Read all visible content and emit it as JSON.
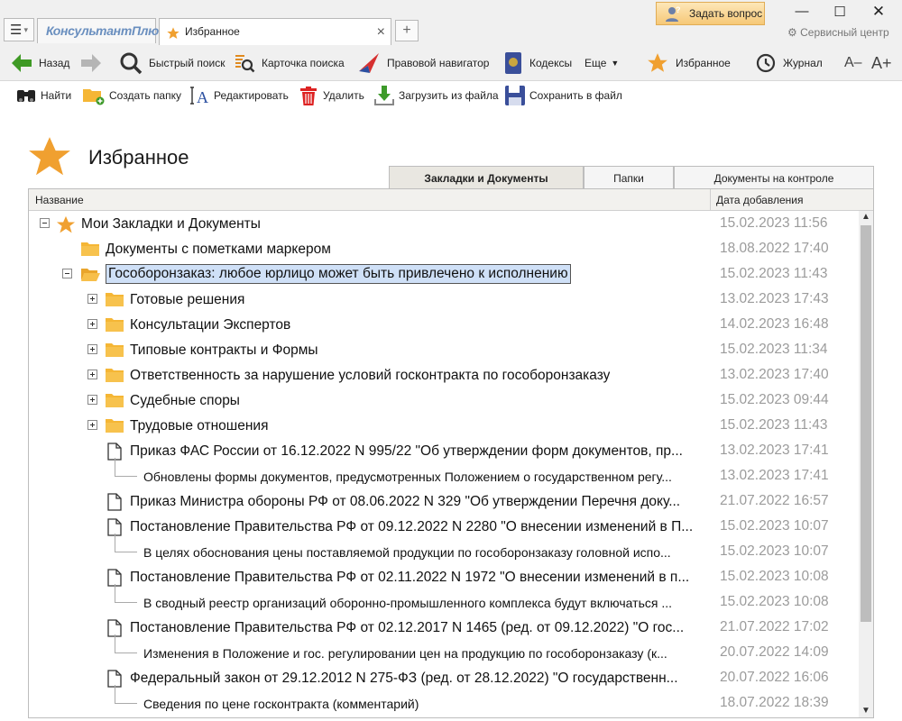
{
  "window": {
    "menu_icon": "hamburger-icon",
    "logo": "КонсультантПлюс",
    "active_tab": "Избранное",
    "ask_question": "Задать вопрос",
    "service_center": "Сервисный центр"
  },
  "toolbar": {
    "back": "Назад",
    "quick_search": "Быстрый поиск",
    "search_card": "Карточка поиска",
    "legal_navigator": "Правовой навигатор",
    "codes": "Кодексы",
    "more": "Еще",
    "favorites": "Избранное",
    "journal": "Журнал",
    "font_smaller": "A–",
    "font_larger": "A+"
  },
  "actions": {
    "find": "Найти",
    "create_folder": "Создать папку",
    "edit": "Редактировать",
    "delete": "Удалить",
    "load_from_file": "Загрузить из файла",
    "save_to_file": "Сохранить в файл"
  },
  "page": {
    "title": "Избранное",
    "tabs": [
      "Закладки и Документы",
      "Папки",
      "Документы на контроле"
    ],
    "active_tab_index": 0
  },
  "table": {
    "col_name": "Название",
    "col_date": "Дата добавления",
    "rows": [
      {
        "type": "root",
        "label": "Мои Закладки и Документы",
        "date": "15.02.2023 11:56"
      },
      {
        "type": "folder",
        "label": "Документы с пометками маркером",
        "date": "18.08.2022 17:40"
      },
      {
        "type": "folder-open",
        "label": "Гособоронзаказ: любое юрлицо может быть привлечено к исполнению",
        "date": "15.02.2023 11:43",
        "selected": true
      },
      {
        "type": "subfolder",
        "label": "Готовые решения",
        "date": "13.02.2023 17:43"
      },
      {
        "type": "subfolder",
        "label": "Консультации Экспертов",
        "date": "14.02.2023 16:48"
      },
      {
        "type": "subfolder",
        "label": "Типовые контракты и Формы",
        "date": "15.02.2023 11:34"
      },
      {
        "type": "subfolder",
        "label": "Ответственность за нарушение условий госконтракта по гособоронзаказу",
        "date": "13.02.2023 17:40"
      },
      {
        "type": "subfolder",
        "label": "Судебные споры",
        "date": "15.02.2023 09:44"
      },
      {
        "type": "subfolder",
        "label": "Трудовые отношения",
        "date": "15.02.2023 11:43"
      },
      {
        "type": "doc",
        "label": "Приказ ФАС России от 16.12.2022 N 995/22 \"Об утверждении форм документов, пр...",
        "date": "13.02.2023 17:41"
      },
      {
        "type": "bookmark",
        "label": "Обновлены формы документов, предусмотренных Положением о государственном регу...",
        "date": "13.02.2023 17:41"
      },
      {
        "type": "doc",
        "label": "Приказ Министра обороны РФ от 08.06.2022 N 329 \"Об утверждении Перечня доку...",
        "date": "21.07.2022 16:57"
      },
      {
        "type": "doc",
        "label": "Постановление Правительства РФ от 09.12.2022 N 2280 \"О внесении изменений в П...",
        "date": "15.02.2023 10:07"
      },
      {
        "type": "bookmark",
        "label": "В целях обоснования цены поставляемой продукции по гособоронзаказу головной испо...",
        "date": "15.02.2023 10:07"
      },
      {
        "type": "doc",
        "label": "Постановление Правительства РФ от 02.11.2022 N 1972 \"О внесении изменений в п...",
        "date": "15.02.2023 10:08"
      },
      {
        "type": "bookmark",
        "label": "В сводный реестр организаций оборонно-промышленного комплекса будут включаться ...",
        "date": "15.02.2023 10:08"
      },
      {
        "type": "doc",
        "label": "Постановление Правительства РФ от 02.12.2017 N 1465 (ред. от 09.12.2022) \"О гос...",
        "date": "21.07.2022 17:02"
      },
      {
        "type": "bookmark",
        "label": "Изменения в Положение и гос. регулировании цен на продукцию по гособоронзаказу (к...",
        "date": "20.07.2022 14:09"
      },
      {
        "type": "doc",
        "label": "Федеральный закон от 29.12.2012 N 275-ФЗ (ред. от 28.12.2022) \"О государственн...",
        "date": "20.07.2022 16:06"
      },
      {
        "type": "bookmark",
        "label": "Сведения по цене госконтракта (комментарий)",
        "date": "18.07.2022 18:39"
      }
    ]
  }
}
